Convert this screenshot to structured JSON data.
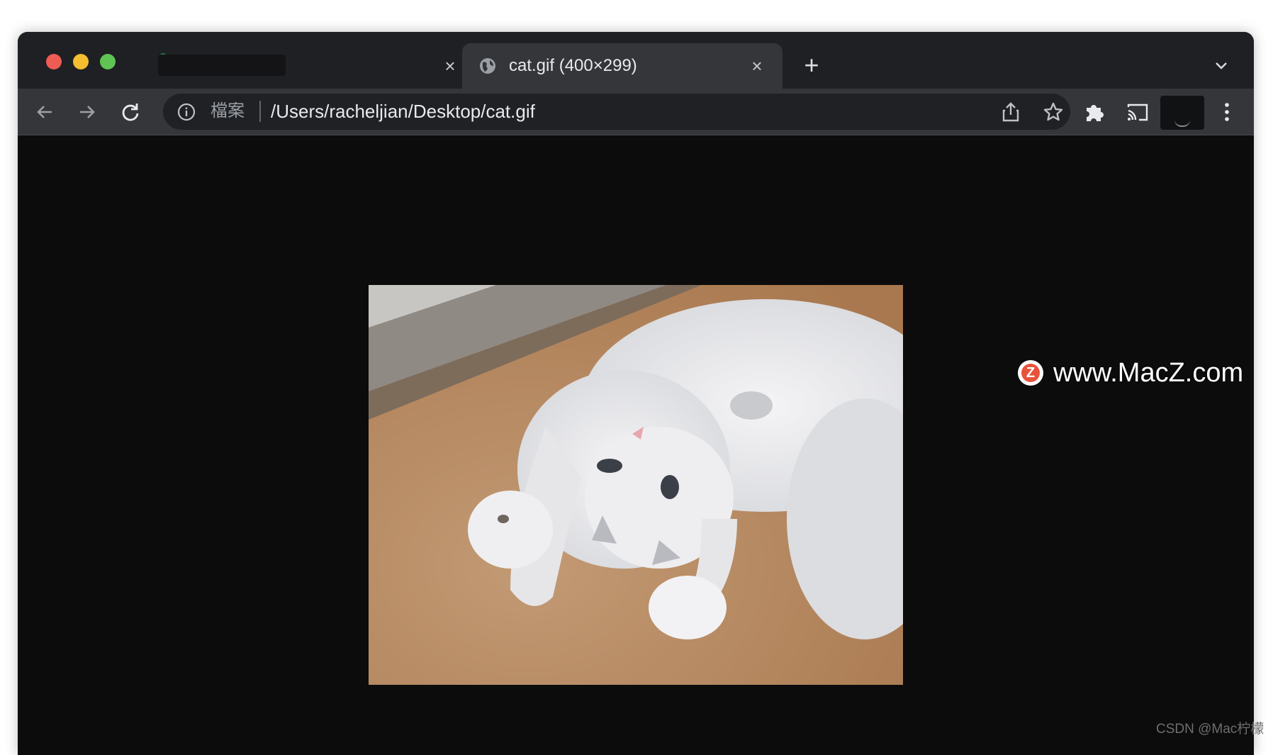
{
  "browser": {
    "tabs": [
      {
        "title": "",
        "active": false
      },
      {
        "title": "cat.gif (400×299)",
        "active": true
      }
    ],
    "new_tab_label": "+",
    "tab_close_glyph": "×"
  },
  "address_bar": {
    "chip_label": "檔案",
    "url": "/Users/racheljian/Desktop/cat.gif"
  },
  "content": {
    "image_alt": "cat.gif",
    "image_dimensions": "400×299"
  },
  "watermark": {
    "logo_letter": "Z",
    "text": "www.MacZ.com"
  },
  "credit": {
    "text": "CSDN @Mac柠檬"
  },
  "colors": {
    "traffic_red": "#ee5c54",
    "traffic_yellow": "#f5bd30",
    "traffic_green": "#5fc454",
    "toolbar_bg": "#35363a",
    "titlebar_bg": "#1f2023",
    "content_bg": "#0c0c0d",
    "watermark_logo": "#e8533b"
  }
}
